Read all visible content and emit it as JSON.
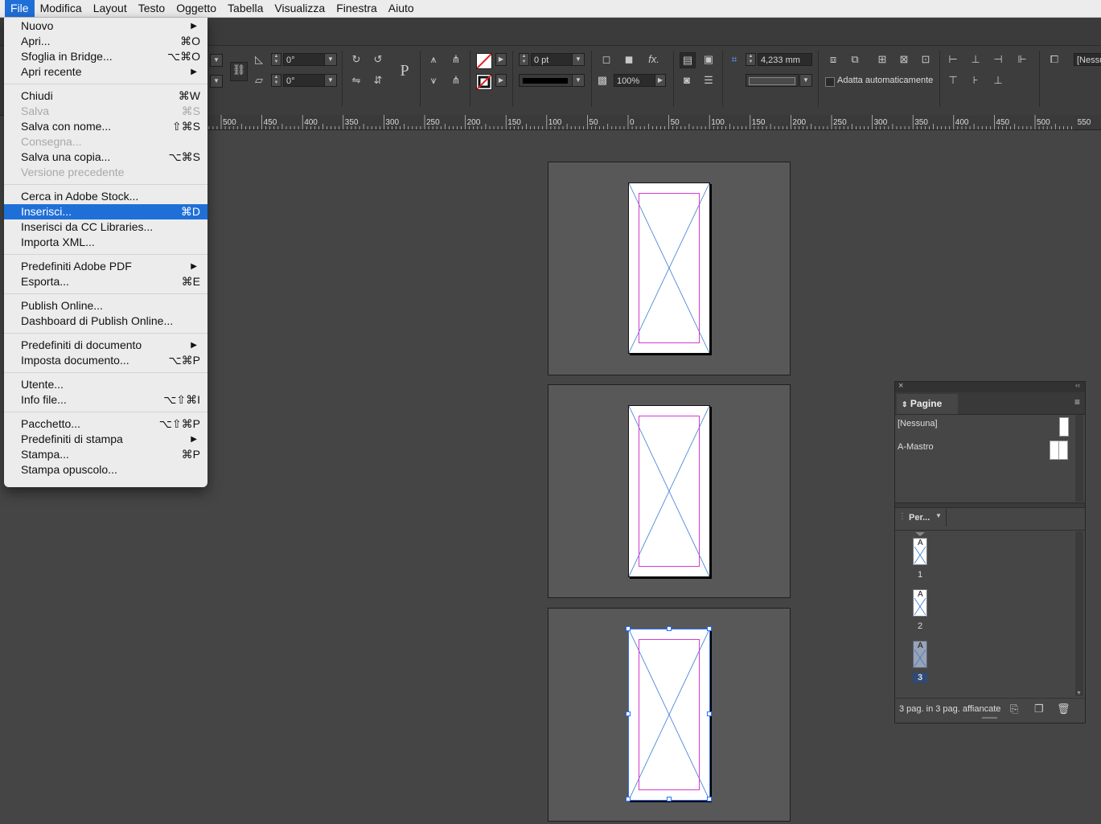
{
  "menubar": {
    "items": [
      "File",
      "Modifica",
      "Layout",
      "Testo",
      "Oggetto",
      "Tabella",
      "Visualizza",
      "Finestra",
      "Aiuto"
    ],
    "active": "File"
  },
  "file_menu": {
    "groups": [
      [
        {
          "label": "Nuovo",
          "submenu": true
        },
        {
          "label": "Apri...",
          "shortcut": "⌘O"
        },
        {
          "label": "Sfoglia in Bridge...",
          "shortcut": "⌥⌘O"
        },
        {
          "label": "Apri recente",
          "submenu": true
        }
      ],
      [
        {
          "label": "Chiudi",
          "shortcut": "⌘W"
        },
        {
          "label": "Salva",
          "shortcut": "⌘S",
          "disabled": true
        },
        {
          "label": "Salva con nome...",
          "shortcut": "⇧⌘S"
        },
        {
          "label": "Consegna...",
          "disabled": true
        },
        {
          "label": "Salva una copia...",
          "shortcut": "⌥⌘S"
        },
        {
          "label": "Versione precedente",
          "disabled": true
        }
      ],
      [
        {
          "label": "Cerca in Adobe Stock..."
        },
        {
          "label": "Inserisci...",
          "shortcut": "⌘D",
          "highlighted": true
        },
        {
          "label": "Inserisci da CC Libraries..."
        },
        {
          "label": "Importa XML..."
        }
      ],
      [
        {
          "label": "Predefiniti Adobe PDF",
          "submenu": true
        },
        {
          "label": "Esporta...",
          "shortcut": "⌘E"
        }
      ],
      [
        {
          "label": "Publish Online..."
        },
        {
          "label": "Dashboard di Publish Online..."
        }
      ],
      [
        {
          "label": "Predefiniti di documento",
          "submenu": true
        },
        {
          "label": "Imposta documento...",
          "shortcut": "⌥⌘P"
        }
      ],
      [
        {
          "label": "Utente..."
        },
        {
          "label": "Info file...",
          "shortcut": "⌥⇧⌘I"
        }
      ],
      [
        {
          "label": "Pacchetto...",
          "shortcut": "⌥⇧⌘P"
        },
        {
          "label": "Predefiniti di stampa",
          "submenu": true
        },
        {
          "label": "Stampa...",
          "shortcut": "⌘P"
        },
        {
          "label": "Stampa opuscolo..."
        }
      ]
    ]
  },
  "controlbar": {
    "rotation_angle": "0°",
    "shear_angle": "0°",
    "stroke_weight": "0 pt",
    "opacity": "100%",
    "fitting_offset": "4,233 mm",
    "auto_fit_label": "Adatta automaticamente",
    "paragraph_style_value": "[Nessu",
    "glyph_p": "P",
    "fx_label": "fx."
  },
  "ruler": {
    "labels": [
      "500",
      "450",
      "400",
      "350",
      "300",
      "250",
      "200",
      "150",
      "100",
      "50",
      "0",
      "50",
      "100",
      "150",
      "200",
      "250",
      "300",
      "350",
      "400",
      "450",
      "500",
      "550"
    ]
  },
  "pages_panel": {
    "tab_label": "Pagine",
    "masters": [
      "[Nessuna]",
      "A-Mastro"
    ],
    "view_menu_label": "Per...",
    "pages": [
      {
        "master_prefix": "A",
        "number": "1",
        "selected": false
      },
      {
        "master_prefix": "A",
        "number": "2",
        "selected": false
      },
      {
        "master_prefix": "A",
        "number": "3",
        "selected": true
      }
    ],
    "status": "3 pag. in 3 pag. affiancate"
  },
  "colors": {
    "menu_highlight": "#1f6fd8",
    "margin_guide": "#d23cd2",
    "frame_cross": "#3a7bd5",
    "selection": "#2a6ef5"
  }
}
